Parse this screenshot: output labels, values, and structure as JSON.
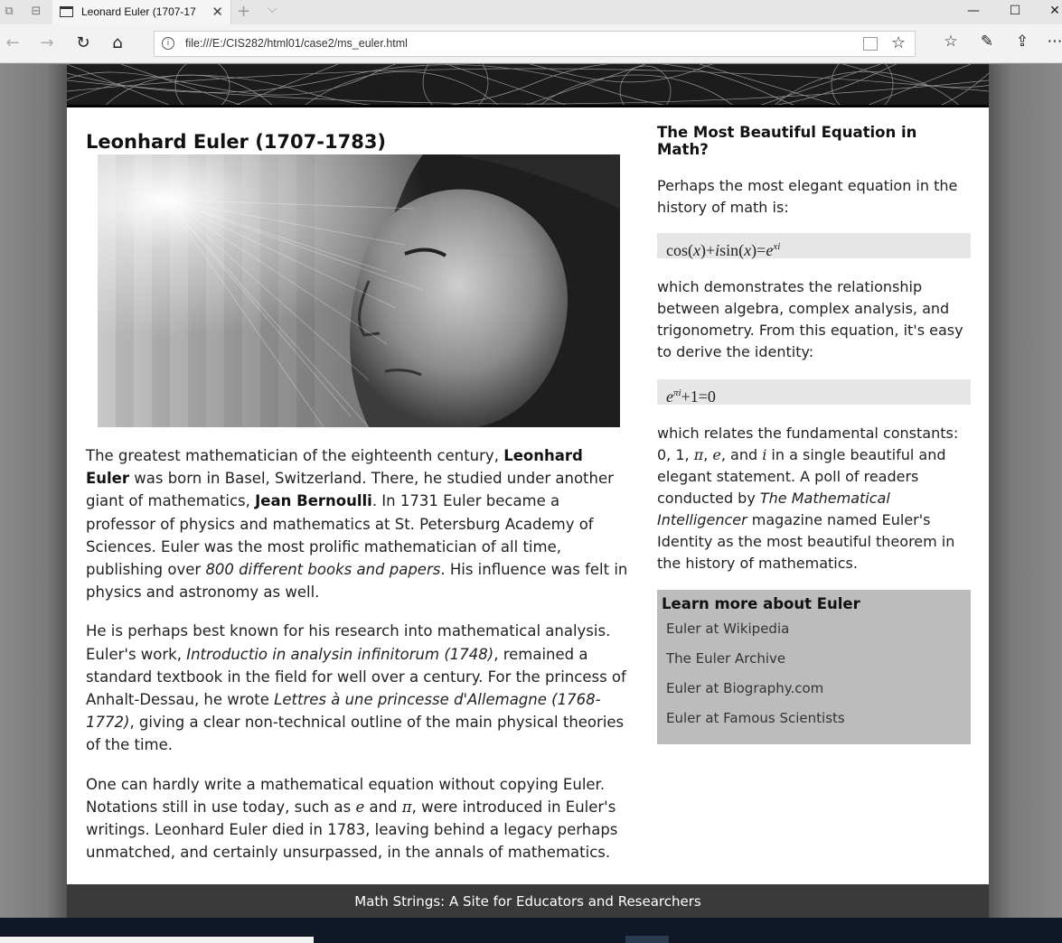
{
  "browser": {
    "tab_title": "Leonard Euler (1707-17",
    "url": "file:///E:/CIS282/html01/case2/ms_euler.html"
  },
  "page": {
    "heading": "Leonhard Euler (1707-1783)",
    "p1": {
      "a": "The greatest mathematician of the eighteenth century, ",
      "b1": "Leonhard Euler",
      "c": " was born in Basel, Switzerland. There, he studied under another giant of mathematics, ",
      "b2": "Jean Bernoulli",
      "d": ". In 1731 Euler became a professor of physics and mathematics at St. Petersburg Academy of Sciences. Euler was the most prolific mathematician of all time, publishing over ",
      "i1": "800 different books and papers",
      "e": ". His influence was felt in physics and astronomy as well."
    },
    "p2": {
      "a": "He is perhaps best known for his research into mathematical analysis. Euler's work, ",
      "i1": "Introductio in analysin infinitorum (1748)",
      "b": ", remained a standard textbook in the field for well over a century. For the princess of Anhalt-Dessau, he wrote ",
      "i2": "Lettres à une princesse d'Allemagne (1768-1772)",
      "c": ", giving a clear non-technical outline of the main physical theories of the time."
    },
    "p3": {
      "a": "One can hardly write a mathematical equation without copying Euler. Notations still in use today, such as ",
      "e": "e",
      "and": " and ",
      "pi": "π",
      "b": ", were introduced in Euler's writings. Leonhard Euler died in 1783, leaving behind a legacy perhaps unmatched, and certainly unsurpassed, in the annals of mathematics."
    }
  },
  "aside": {
    "heading": "The Most Beautiful Equation in Math?",
    "intro": "Perhaps the most elegant equation in the history of math is:",
    "mid": "which demonstrates the relationship between algebra, complex analysis, and trigonometry. From this equation, it's easy to derive the identity:",
    "outro": {
      "a": "which relates the fundamental constants: 0, 1, ",
      "pi": "π",
      "sep1": ", ",
      "e": "e",
      "sep2": ", and ",
      "i": "i",
      "b": " in a single beautiful and elegant statement. A poll of readers conducted by ",
      "mag": "The Mathematical Intelligencer",
      "c": " magazine named Euler's Identity as the most beautiful theorem in the history of mathematics."
    },
    "links_heading": "Learn more about Euler",
    "links": [
      "Euler at Wikipedia",
      "The Euler Archive",
      "Euler at Biography.com",
      "Euler at Famous Scientists"
    ]
  },
  "footer": "Math Strings: A Site for Educators and Researchers"
}
